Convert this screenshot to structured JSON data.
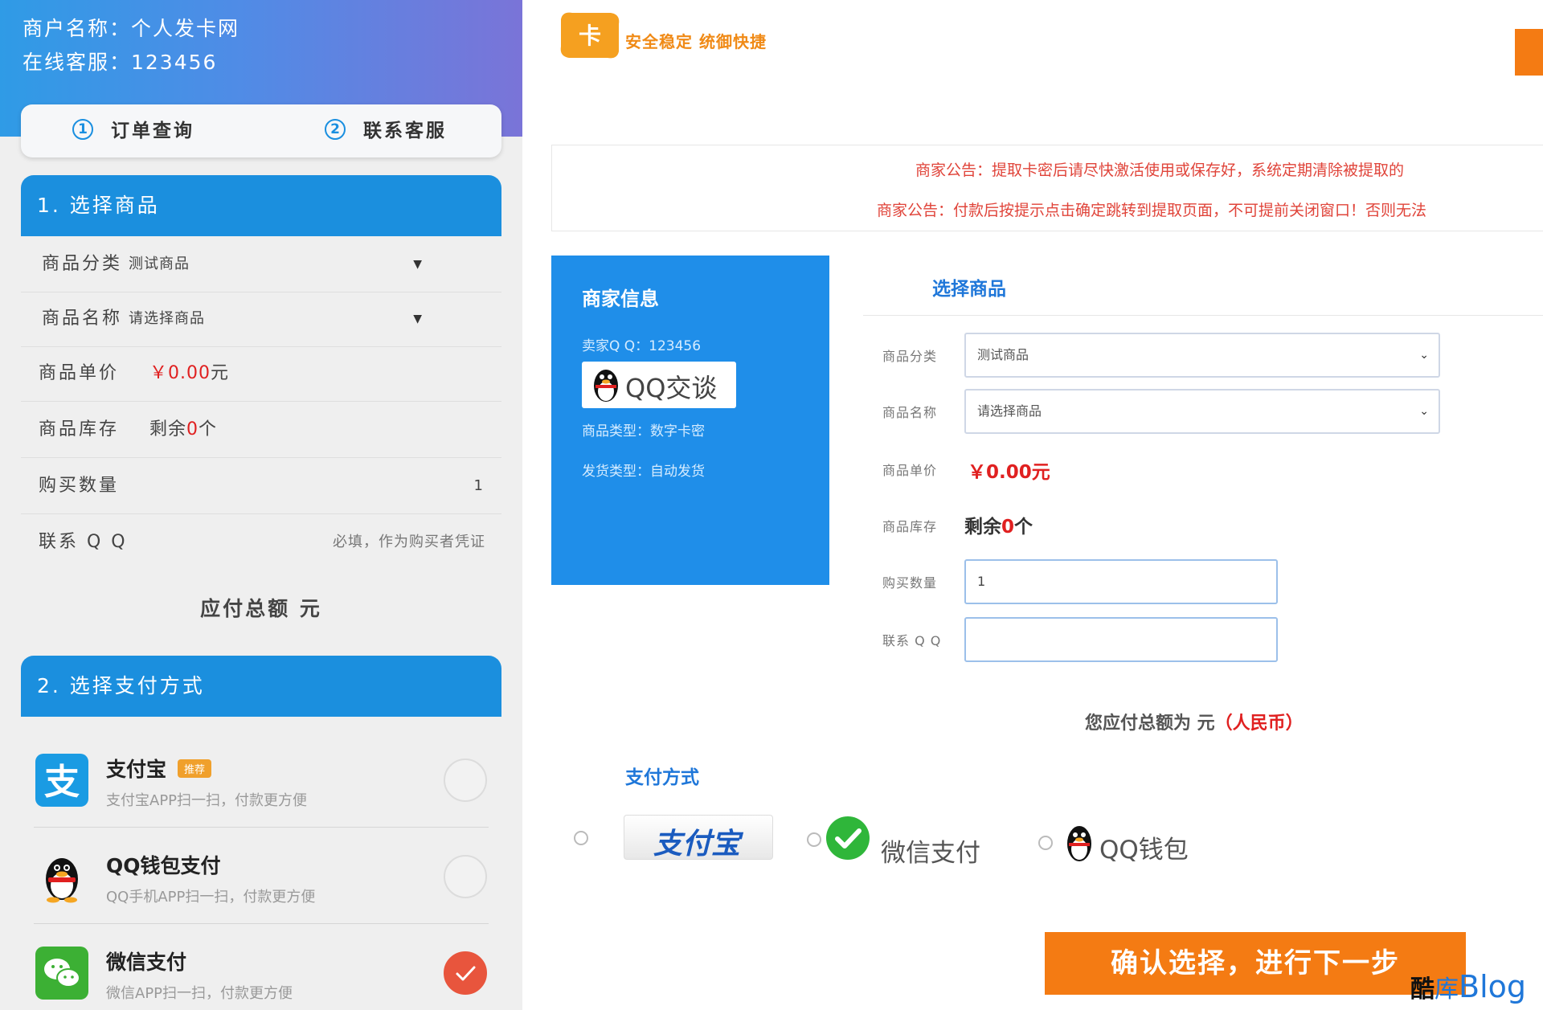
{
  "mobile": {
    "merchant_name": "商户名称：个人发卡网",
    "online_service": "在线客服：123456",
    "tabs": [
      {
        "num": "1",
        "label": "订单查询"
      },
      {
        "num": "2",
        "label": "联系客服"
      }
    ],
    "section1_title": "1. 选择商品",
    "category_label": "商品分类",
    "category_value": "测试商品",
    "product_label": "商品名称",
    "product_value": "请选择商品",
    "price_label": "商品单价",
    "price_value": "￥0.00",
    "price_unit": "元",
    "stock_label": "商品库存",
    "stock_prefix": "剩余",
    "stock_value": "0",
    "stock_unit": "个",
    "quantity_label": "购买数量",
    "quantity_value": "1",
    "qq_label": "联系 Q Q",
    "qq_placeholder": "必填，作为购买者凭证",
    "total_label": "应付总额 元",
    "section2_title": "2. 选择支付方式",
    "pay_methods": [
      {
        "title": "支付宝",
        "badge": "推荐",
        "sub": "支付宝APP扫一扫，付款更方便",
        "selected": false,
        "icon": "alipay-icon"
      },
      {
        "title": "QQ钱包支付",
        "sub": "QQ手机APP扫一扫，付款更方便",
        "selected": false,
        "icon": "qq-penguin-icon"
      },
      {
        "title": "微信支付",
        "sub": "微信APP扫一扫，付款更方便",
        "selected": true,
        "icon": "wechat-icon"
      }
    ]
  },
  "desktop": {
    "logo_text": "安全稳定  统御快捷",
    "notices": [
      "商家公告：提取卡密后请尽快激活使用或保存好，系统定期清除被提取的",
      "商家公告：付款后按提示点击确定跳转到提取页面，不可提前关闭窗口！否则无法"
    ],
    "info": {
      "title": "商家信息",
      "qq": "卖家Q Q：123456",
      "qq_talk": "QQ交谈",
      "product_type": "商品类型：数字卡密",
      "delivery_type": "发货类型：自动发货"
    },
    "select_title": "选择商品",
    "category_label": "商品分类",
    "category_value": "测试商品",
    "product_label": "商品名称",
    "product_value": "请选择商品",
    "price_label": "商品单价",
    "price_value": "￥0.00元",
    "stock_label": "商品库存",
    "stock_prefix": "剩余",
    "stock_value": "0",
    "stock_unit": "个",
    "quantity_label": "购买数量",
    "quantity_value": "1",
    "qq_label": "联系 Q Q",
    "qq_value": "",
    "total_text": "您应付总额为 元",
    "total_currency": "（人民币）",
    "pay_title": "支付方式",
    "pay_options": [
      {
        "label": "支付宝",
        "icon": "alipay-logo-icon"
      },
      {
        "label": "微信支付",
        "icon": "wechat-icon"
      },
      {
        "label": "QQ钱包",
        "icon": "qq-penguin-icon"
      }
    ],
    "confirm_button": "确认选择，进行下一步",
    "watermark": {
      "part1": "酷",
      "part2": "库",
      "part3": "Blog"
    }
  },
  "colors": {
    "blue": "#1b8fde",
    "orange": "#f47b13",
    "red": "#e02020",
    "selected_radio": "#e8553d"
  }
}
